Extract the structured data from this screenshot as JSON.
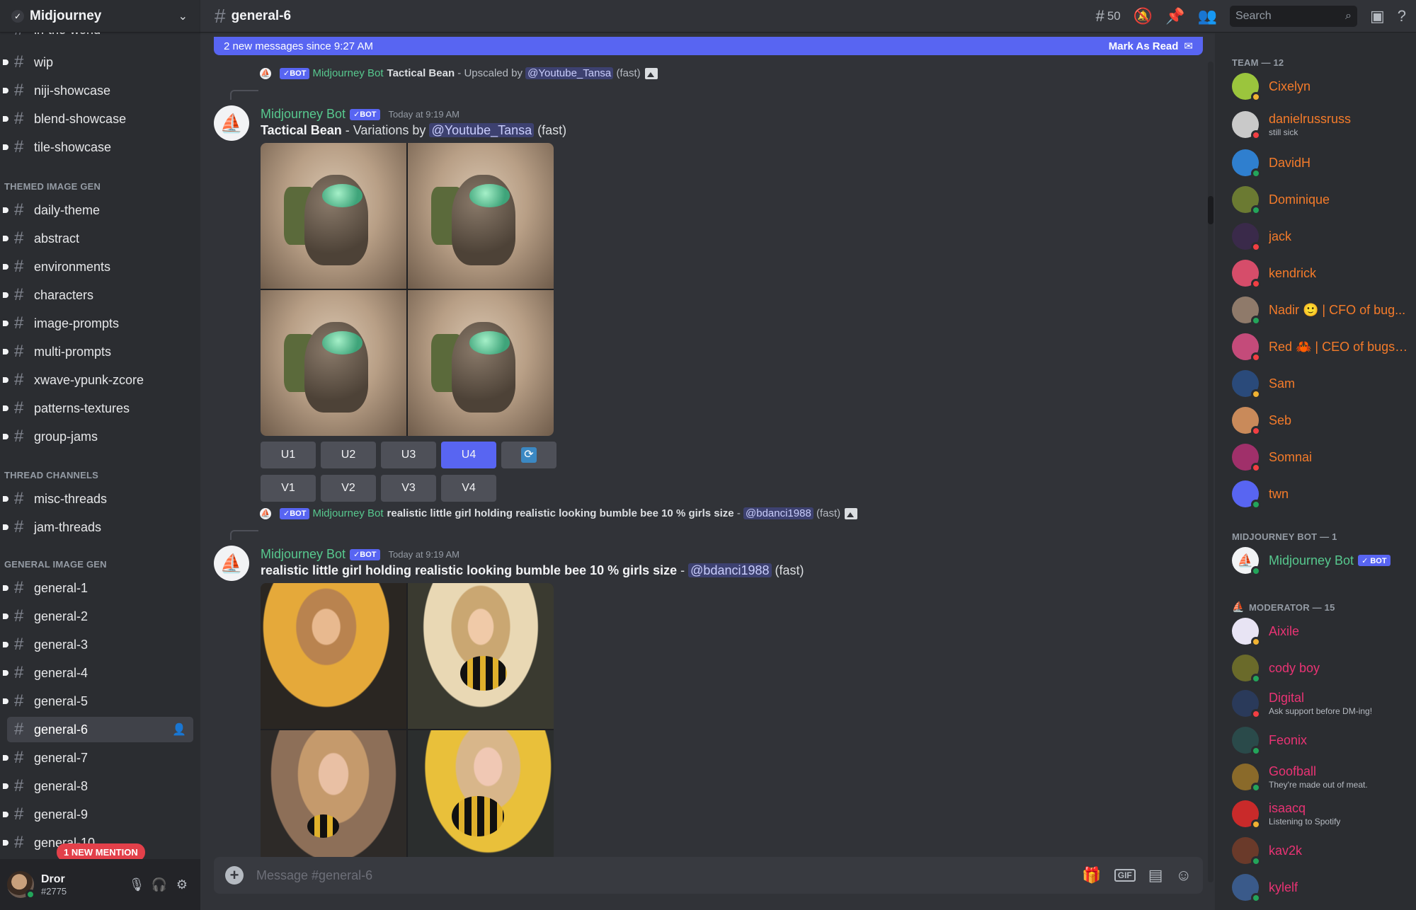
{
  "server": {
    "name": "Midjourney"
  },
  "sidebar": {
    "partial_top": "in-the-world",
    "channels_top": [
      "wip",
      "niji-showcase",
      "blend-showcase",
      "tile-showcase"
    ],
    "cat_themed": "THEMED IMAGE GEN",
    "themed": [
      "daily-theme",
      "abstract",
      "environments",
      "characters",
      "image-prompts",
      "multi-prompts",
      "xwave-ypunk-zcore",
      "patterns-textures",
      "group-jams"
    ],
    "cat_thread": "THREAD CHANNELS",
    "threads": [
      "misc-threads",
      "jam-threads"
    ],
    "cat_general": "GENERAL IMAGE GEN",
    "general": [
      "general-1",
      "general-2",
      "general-3",
      "general-4",
      "general-5",
      "general-6",
      "general-7",
      "general-8",
      "general-9",
      "general-10"
    ],
    "mention_pill": "1 NEW MENTION"
  },
  "user": {
    "name": "Dror",
    "tag": "#2775"
  },
  "topbar": {
    "channel": "general-6",
    "thread_count": "50",
    "search_placeholder": "Search"
  },
  "newbar": {
    "text": "2 new messages since 9:27 AM",
    "action": "Mark As Read"
  },
  "bot_badge": "BOT",
  "message1": {
    "reply_author": "Midjourney Bot",
    "reply_title": "Tactical Bean",
    "reply_rest": " - Upscaled by ",
    "reply_mention": "@Youtube_Tansa",
    "reply_speed": " (fast)",
    "author": "Midjourney Bot",
    "time": "Today at 9:19 AM",
    "title": "Tactical Bean",
    "rest": " - Variations by ",
    "mention": "@Youtube_Tansa",
    "speed": " (fast)",
    "buttons_u": [
      "U1",
      "U2",
      "U3",
      "U4"
    ],
    "buttons_v": [
      "V1",
      "V2",
      "V3",
      "V4"
    ],
    "selected_button": "U4"
  },
  "message2": {
    "reply_author": "Midjourney Bot",
    "reply_title": "realistic little girl holding realistic looking bumble bee 10 % girls size",
    "reply_rest": " - ",
    "reply_mention": "@bdanci1988",
    "reply_speed": " (fast)",
    "author": "Midjourney Bot",
    "time": "Today at 9:19 AM",
    "title": "realistic little girl holding realistic looking bumble bee 10 % girls size",
    "rest": " - ",
    "mention": "@bdanci1988",
    "speed": " (fast)"
  },
  "composer": {
    "placeholder": "Message #general-6",
    "gif": "GIF"
  },
  "members": {
    "team_header": "TEAM — 12",
    "team": [
      {
        "name": "Cixelyn",
        "status": "",
        "color": "#f47b2a"
      },
      {
        "name": "danielrussruss",
        "status": "still sick",
        "color": "#f47b2a"
      },
      {
        "name": "DavidH",
        "status": "",
        "color": "#f47b2a"
      },
      {
        "name": "Dominique",
        "status": "",
        "color": "#f47b2a"
      },
      {
        "name": "jack",
        "status": "",
        "color": "#f47b2a"
      },
      {
        "name": "kendrick",
        "status": "",
        "color": "#f47b2a"
      },
      {
        "name": "Nadir 🙂 | CFO of bug...",
        "status": "",
        "color": "#f47b2a"
      },
      {
        "name": "Red 🦀 | CEO of bugs ...",
        "status": "",
        "color": "#f47b2a"
      },
      {
        "name": "Sam",
        "status": "",
        "color": "#f47b2a"
      },
      {
        "name": "Seb",
        "status": "",
        "color": "#f47b2a"
      },
      {
        "name": "Somnai",
        "status": "",
        "color": "#f47b2a"
      },
      {
        "name": "twn",
        "status": "",
        "color": "#f47b2a"
      }
    ],
    "bot_header": "MIDJOURNEY BOT — 1",
    "bot": {
      "name": "Midjourney Bot"
    },
    "mod_header": "MODERATOR — 15",
    "mods": [
      {
        "name": "Aixile",
        "status": ""
      },
      {
        "name": "cody boy",
        "status": ""
      },
      {
        "name": "Digital",
        "status": "Ask support before DM-ing!"
      },
      {
        "name": "Feonix",
        "status": ""
      },
      {
        "name": "Goofball",
        "status": "They're made out of meat."
      },
      {
        "name": "isaacq",
        "status": "Listening to Spotify"
      },
      {
        "name": "kav2k",
        "status": ""
      },
      {
        "name": "kylelf",
        "status": ""
      }
    ]
  },
  "colors": {
    "accent": "#5865f2",
    "bot_green": "#57c88e",
    "team_orange": "#f47b2a",
    "mod_pink": "#e93374"
  }
}
